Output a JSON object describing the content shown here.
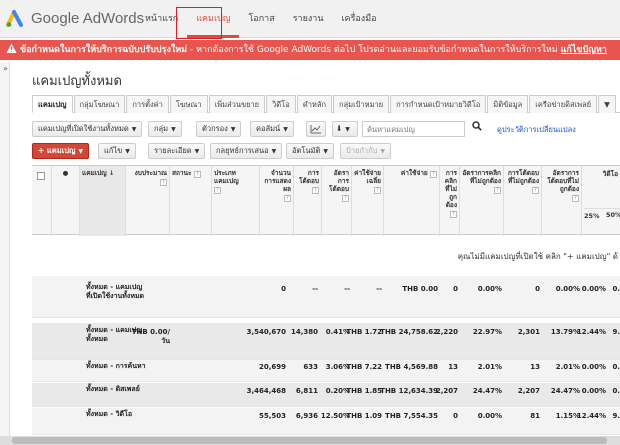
{
  "brand": {
    "name": "Google AdWords",
    "logo_colors": [
      "#4285f4",
      "#fbbc05",
      "#34a853"
    ]
  },
  "nav": {
    "items": [
      {
        "label": "หน้าแรก",
        "active": false
      },
      {
        "label": "แคมเปญ",
        "active": true
      },
      {
        "label": "โอกาส",
        "active": false
      },
      {
        "label": "รายงาน",
        "active": false
      },
      {
        "label": "เครื่องมือ",
        "active": false
      }
    ],
    "accent": "#dd4b39"
  },
  "alert": {
    "bold_text": "ข้อกำหนดในการให้บริการฉบับปรับปรุงใหม่",
    "text": " - หากต้องการใช้ Google AdWords ต่อไป โปรดอ่านและยอมรับข้อกำหนดในการให้บริการใหม่ ",
    "link": "แก้ไขปัญหา",
    "color": "#e8554e"
  },
  "side_toggle": "»",
  "page_title": "แคมเปญทั้งหมด",
  "tabs": [
    {
      "label": "แคมเปญ",
      "active": true
    },
    {
      "label": "กลุ่มโฆษณา"
    },
    {
      "label": "การตั้งค่า"
    },
    {
      "label": "โฆษณา"
    },
    {
      "label": "เพิ่มส่วนขยาย"
    },
    {
      "label": "วิดีโอ"
    },
    {
      "label": "คำหลัก"
    },
    {
      "label": "กลุ่มเป้าหมาย"
    },
    {
      "label": "การกำหนดเป้าหมายวิดีโอ"
    },
    {
      "label": "มิติข้อมูล"
    },
    {
      "label": "เครือข่ายดิสเพลย์"
    }
  ],
  "tabs_more": "▼",
  "toolbar1": {
    "filter": "แคมเปญที่เปิดใช้งานทั้งหมด",
    "segment": "กลุ่ม",
    "filter2": "ตัวกรอง",
    "columns": "คอลัมน์",
    "search_placeholder": "ค้นหาแคมเปญ",
    "search_icon": "search-icon",
    "history_link": "ดูประวัติการเปลี่ยนแปลง"
  },
  "toolbar2": {
    "add_campaign": "แคมเปญ",
    "edit": "แก้ไข",
    "details": "รายละเอียด",
    "bid_strategy": "กลยุทธ์การเสนอ",
    "automate": "อัตโนมัติ",
    "labels": "ป้ายกำกับ"
  },
  "table": {
    "headers": [
      "แคมเปญ",
      "งบประมาณ",
      "สถานะ",
      "ประเภทแคมเปญ",
      "จำนวนการแสดงผล",
      "การโต้ตอบ",
      "อัตราการโต้ตอบ",
      "ค่าใช้จ่ายเฉลี่ย",
      "ค่าใช้จ่าย",
      "การคลิกที่ไม่ถูกต้อง",
      "อัตราการคลิกที่ไม่ถูกต้อง",
      "การโต้ตอบที่ไม่ถูกต้อง",
      "อัตราการโต้ตอบที่ไม่ถูกต้อง",
      "วิดีโอ"
    ],
    "subheaders": [
      "25%",
      "50%"
    ],
    "empty_message": "คุณไม่มีแคมเปญที่เปิดใช้ คลิก \"+ แคมเปญ\" ด้",
    "rows": [
      {
        "label": "ทั้งหมด - แคมเปญที่เปิดใช้งานทั้งหมด",
        "budget": "",
        "impressions": "0",
        "interactions": "--",
        "int_rate": "--",
        "avg_cost": "--",
        "cost": "THB 0.00",
        "invalid_clicks": "0",
        "invalid_rate": "0.00%",
        "invalid_int": "0",
        "invalid_int_rate": "0.00%",
        "p25": "0.00%",
        "p50": "0."
      },
      {
        "label": "ทั้งหมด - แคมเปญทั้งหมด",
        "budget": "THB 0.00/วัน",
        "impressions": "3,540,670",
        "interactions": "14,380",
        "int_rate": "0.41%",
        "avg_cost": "THB 1.72",
        "cost": "THB 24,758.62",
        "invalid_clicks": "2,220",
        "invalid_rate": "22.97%",
        "invalid_int": "2,301",
        "invalid_int_rate": "13.79%",
        "p25": "12.44%",
        "p50": "9."
      },
      {
        "label": "ทั้งหมด - การค้นหา",
        "budget": "",
        "impressions": "20,699",
        "interactions": "633",
        "int_rate": "3.06%",
        "avg_cost": "THB 7.22",
        "cost": "THB 4,569.88",
        "invalid_clicks": "13",
        "invalid_rate": "2.01%",
        "invalid_int": "13",
        "invalid_int_rate": "2.01%",
        "p25": "0.00%",
        "p50": "0."
      },
      {
        "label": "ทั้งหมด - ดิสเพลย์",
        "budget": "",
        "impressions": "3,464,468",
        "interactions": "6,811",
        "int_rate": "0.20%",
        "avg_cost": "THB 1.85",
        "cost": "THB 12,634.39",
        "invalid_clicks": "2,207",
        "invalid_rate": "24.47%",
        "invalid_int": "2,207",
        "invalid_int_rate": "24.47%",
        "p25": "0.00%",
        "p50": "0."
      },
      {
        "label": "ทั้งหมด - วิดีโอ",
        "budget": "",
        "impressions": "55,503",
        "interactions": "6,936",
        "int_rate": "12.50%",
        "avg_cost": "THB 1.09",
        "cost": "THB 7,554.35",
        "invalid_clicks": "0",
        "invalid_rate": "0.00%",
        "invalid_int": "81",
        "invalid_int_rate": "1.15%",
        "p25": "12.44%",
        "p50": "9."
      }
    ]
  }
}
